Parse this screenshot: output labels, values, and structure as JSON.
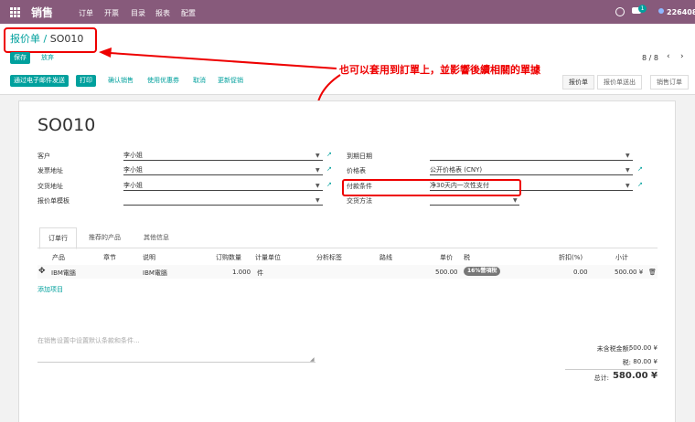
{
  "topbar": {
    "app_name": "销售",
    "menu": [
      "订单",
      "开票",
      "目录",
      "报表",
      "配置"
    ],
    "notification_count": "1",
    "user_id": "226408"
  },
  "breadcrumb": {
    "parent": "报价单",
    "separator": "/",
    "current": "SO010"
  },
  "actions": {
    "save": "保存",
    "discard": "放弃"
  },
  "pager": {
    "text": "8 / 8",
    "prev": "‹",
    "next": "›"
  },
  "toolbar": [
    "通过电子邮件发送",
    "打印",
    "确认销售",
    "使用优惠券",
    "取消",
    "更新促销"
  ],
  "status_stages": [
    "报价单",
    "报价单送出",
    "销售订单"
  ],
  "annotation": "也可以套用到訂單上，並影響後續相關的單據",
  "form": {
    "title": "SO010",
    "left_fields": [
      {
        "label": "客户",
        "value": "李小姐"
      },
      {
        "label": "发票地址",
        "value": "李小姐"
      },
      {
        "label": "交货地址",
        "value": "李小姐"
      },
      {
        "label": "报价单模板",
        "value": ""
      }
    ],
    "right_fields": [
      {
        "label": "到期日期",
        "value": ""
      },
      {
        "label": "价格表",
        "value": "公开价格表 (CNY)"
      },
      {
        "label": "付款条件",
        "value": "净30天内一次性支付"
      },
      {
        "label": "交货方法",
        "value": ""
      }
    ]
  },
  "tabs": [
    "订单行",
    "推荐的产品",
    "其他信息"
  ],
  "order_lines": {
    "columns": [
      "产品",
      "章节",
      "说明",
      "订购数量",
      "计量单位",
      "分析标签",
      "路线",
      "单价",
      "税",
      "折扣(%)",
      "小计"
    ],
    "rows": [
      {
        "product": "IBM電腦",
        "description": "IBM電腦",
        "qty": "1.000",
        "uom": "件",
        "price": "500.00",
        "tax": "16%營項稅",
        "discount": "0.00",
        "subtotal": "500.00 ¥"
      }
    ],
    "add_item": "添加项目"
  },
  "terms_placeholder": "在销售设置中设置默认条款和条件...",
  "totals": {
    "untaxed_label": "未含税金额:",
    "untaxed": "500.00 ¥",
    "tax_label": "税:",
    "tax": "80.00 ¥",
    "total_label": "总计:",
    "total": "580.00 ¥"
  }
}
